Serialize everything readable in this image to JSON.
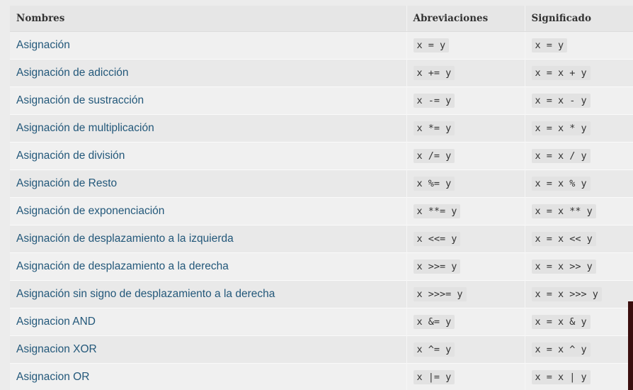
{
  "table": {
    "headers": [
      "Nombres",
      "Abreviaciones",
      "Significado"
    ],
    "rows": [
      {
        "name": "Asignación",
        "abbr": "x = y",
        "meaning": "x = y"
      },
      {
        "name": "Asignación de adicción",
        "abbr": "x += y",
        "meaning": "x = x + y"
      },
      {
        "name": "Asignación de sustracción",
        "abbr": "x -= y",
        "meaning": "x = x - y"
      },
      {
        "name": "Asignación de multiplicación",
        "abbr": "x *= y",
        "meaning": "x = x * y"
      },
      {
        "name": "Asignación de división",
        "abbr": "x /= y",
        "meaning": "x = x / y"
      },
      {
        "name": "Asignación de Resto",
        "abbr": "x %= y",
        "meaning": "x = x % y"
      },
      {
        "name": "Asignación de exponenciación",
        "abbr": "x **= y",
        "meaning": "x = x ** y"
      },
      {
        "name": "Asignación de desplazamiento a la izquierda",
        "abbr": "x <<= y",
        "meaning": "x = x << y"
      },
      {
        "name": "Asignación de desplazamiento a la derecha",
        "abbr": "x >>= y",
        "meaning": "x = x >> y"
      },
      {
        "name": "Asignación sin signo de desplazamiento a la derecha",
        "abbr": "x >>>= y",
        "meaning": "x = x >>> y"
      },
      {
        "name": "Asignacion AND",
        "abbr": "x &= y",
        "meaning": "x = x & y"
      },
      {
        "name": "Asignacion XOR",
        "abbr": "x ^= y",
        "meaning": "x = x ^ y"
      },
      {
        "name": "Asignacion OR",
        "abbr": "x |= y",
        "meaning": "x = x | y"
      }
    ]
  }
}
